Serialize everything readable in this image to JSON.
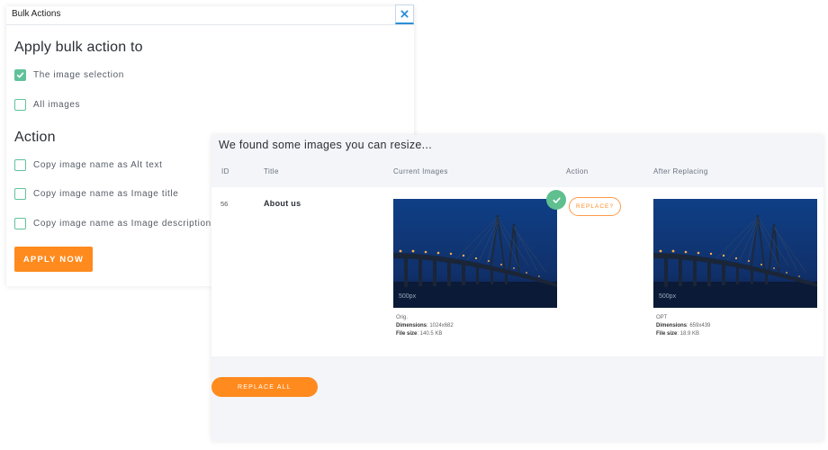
{
  "bulk": {
    "title": "Bulk Actions",
    "heading_apply": "Apply bulk action to",
    "options_apply": [
      {
        "label": "The image selection",
        "checked": true
      },
      {
        "label": "All images",
        "checked": false
      }
    ],
    "heading_action": "Action",
    "options_action": [
      {
        "label": "Copy image name as Alt text",
        "checked": false
      },
      {
        "label": "Copy image name as Image title",
        "checked": false
      },
      {
        "label": "Copy image name as Image description",
        "checked": false
      }
    ],
    "apply_label": "APPLY NOW"
  },
  "resize": {
    "title": "We found some images you can resize...",
    "columns": {
      "id": "ID",
      "title": "Title",
      "current": "Current Images",
      "action": "Action",
      "after": "After Replacing"
    },
    "row": {
      "id": "56",
      "title": "About us",
      "current": {
        "caption": "Orig.",
        "dimensions_label": "Dimensions",
        "dimensions": ": 1024x682",
        "filesize_label": "File size",
        "filesize": ": 140.5 KB",
        "watermark": "500px"
      },
      "replace_label": "REPLACE?",
      "after": {
        "caption": "OPT",
        "dimensions_label": "Dimensions",
        "dimensions": ": 659x439",
        "filesize_label": "File size",
        "filesize": ": 18.9 KB",
        "watermark": "500px"
      }
    },
    "replace_all_label": "REPLACE ALL"
  },
  "colors": {
    "accent": "#ff8a1e",
    "check": "#61c29a",
    "close_x": "#2b8fd8"
  },
  "icons": [
    "close-icon",
    "checkmark-icon",
    "check-circle-icon"
  ]
}
